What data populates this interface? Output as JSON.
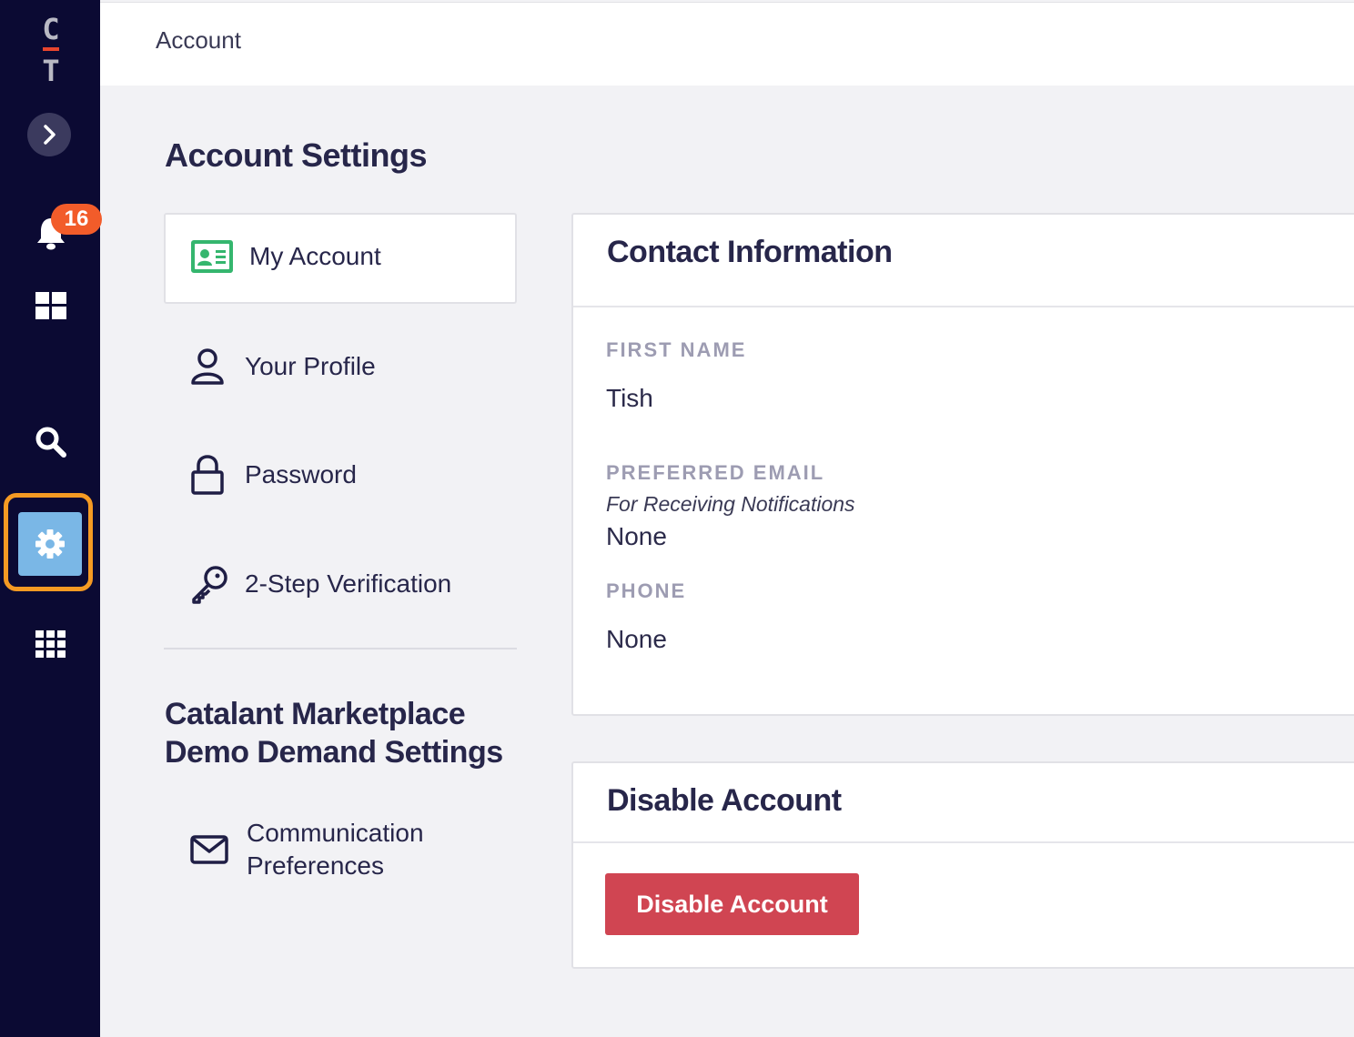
{
  "rail": {
    "logo_top": "C",
    "logo_bottom": "T",
    "notification_count": "16",
    "active_item": "settings",
    "accent_highlight": "#f59a23",
    "active_color": "#7ab7e6"
  },
  "topbar": {
    "breadcrumb": "Account"
  },
  "page": {
    "title": "Account Settings"
  },
  "nav": {
    "items": [
      {
        "label": "My Account",
        "icon": "id-card-icon",
        "selected": true
      },
      {
        "label": "Your Profile",
        "icon": "person-icon"
      },
      {
        "label": "Password",
        "icon": "lock-icon"
      },
      {
        "label": "2-Step Verification",
        "icon": "key-icon"
      }
    ],
    "section_title_line1": "Catalant Marketplace",
    "section_title_line2": "Demo Demand Settings",
    "section_items": [
      {
        "label_line1": "Communication",
        "label_line2": "Preferences",
        "icon": "envelope-icon"
      }
    ]
  },
  "contact": {
    "title": "Contact Information",
    "first_name_label": "FIRST NAME",
    "first_name_value": "Tish",
    "email_label": "PREFERRED EMAIL",
    "email_sublabel": "For Receiving Notifications",
    "email_value": "None",
    "phone_label": "PHONE",
    "phone_value": "None"
  },
  "disable": {
    "title": "Disable Account",
    "button_label": "Disable Account",
    "button_color": "#d04552"
  }
}
